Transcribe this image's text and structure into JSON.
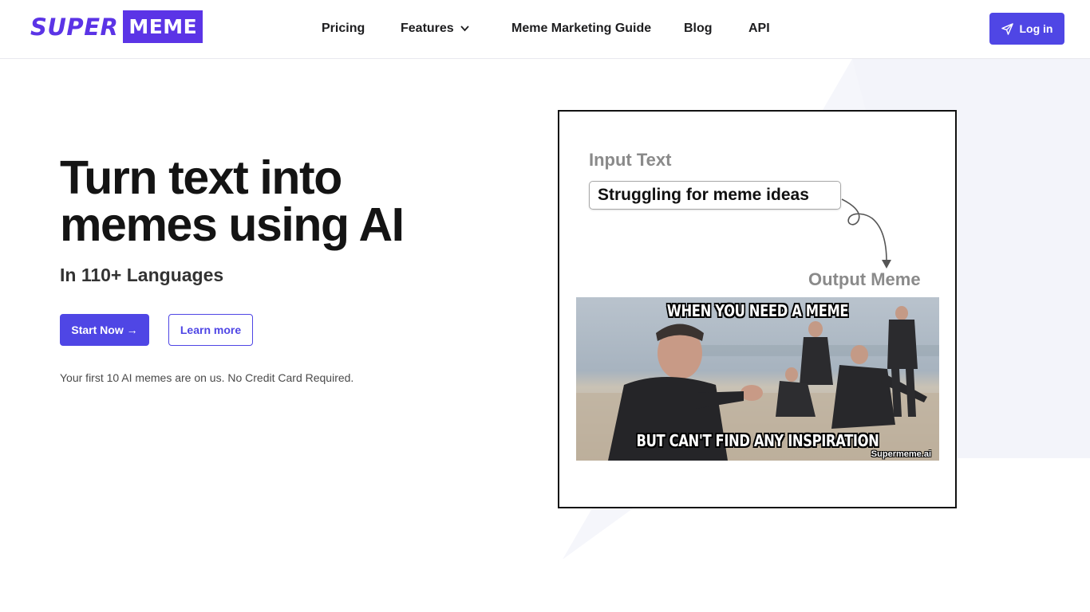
{
  "brand": {
    "logo_part1": "SUPER",
    "logo_part2": "MEME",
    "accent": "#4f46e5",
    "logo_color": "#5b34e6"
  },
  "nav": {
    "items": [
      {
        "label": "Pricing"
      },
      {
        "label": "Features",
        "icon": "chevron-down-icon"
      },
      {
        "label": "Meme Marketing Guide"
      },
      {
        "label": "Blog"
      },
      {
        "label": "API"
      }
    ],
    "login_label": "Log in",
    "login_icon": "paper-plane-icon"
  },
  "hero": {
    "title_line1": "Turn text into",
    "title_line2": "memes using AI",
    "subtitle": "In 110+ Languages",
    "start_label": "Start Now →",
    "learn_label": "Learn more",
    "note": "Your first 10 AI memes are on us. No Credit Card Required."
  },
  "demo": {
    "input_label": "Input Text",
    "input_value": "Struggling for meme ideas",
    "output_label": "Output Meme",
    "meme_top_text": "WHEN YOU NEED A MEME",
    "meme_bottom_text": "BUT CAN'T FIND ANY INSPIRATION",
    "meme_watermark": "Supermeme.ai"
  }
}
